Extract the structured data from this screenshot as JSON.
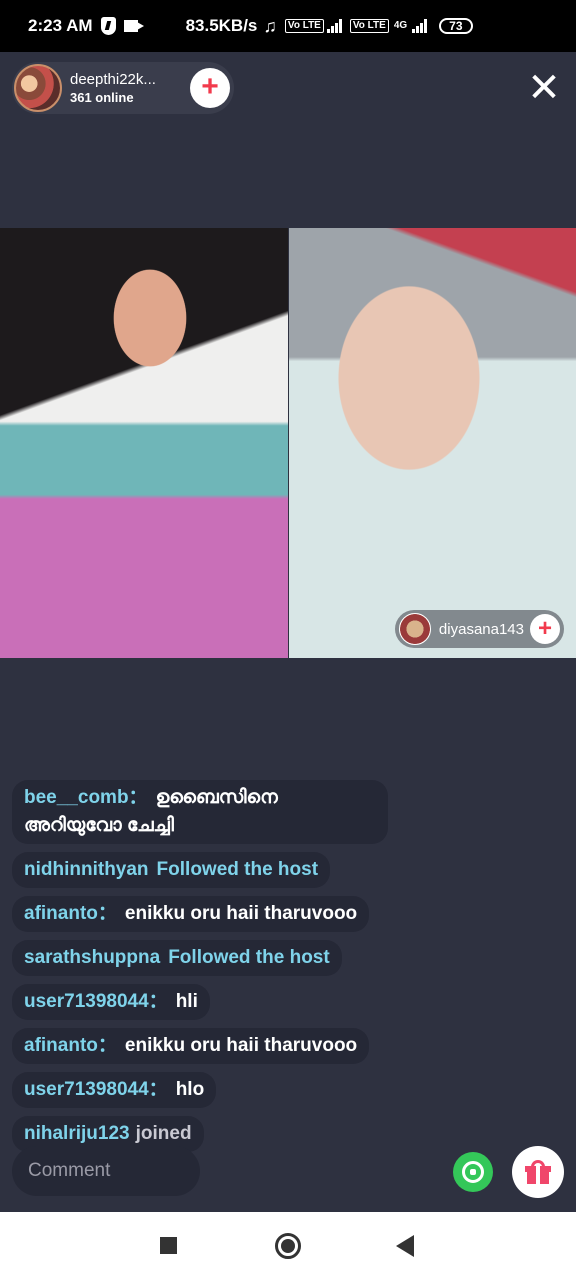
{
  "status_bar": {
    "time": "2:23 AM",
    "speed": "83.5KB/s",
    "volte1": "Vo LTE",
    "volte2": "Vo LTE",
    "network": "4G",
    "battery": "73"
  },
  "host": {
    "name": "deepthi22k...",
    "online": "361 online",
    "follow_icon": "plus-icon"
  },
  "guest": {
    "name": "diyasana143",
    "follow_icon": "plus-icon"
  },
  "chat": [
    {
      "user": "bee__comb",
      "sep": "：",
      "text": "ഉബൈസിനെ അറിയുവോ ചേച്ചി",
      "type": "message"
    },
    {
      "user": "nidhinnithyan",
      "sep": "",
      "text": "Followed the host",
      "type": "system"
    },
    {
      "user": "afinanto",
      "sep": "：",
      "text": "enikku oru haii tharuvooo",
      "type": "message"
    },
    {
      "user": "sarathshuppna",
      "sep": "",
      "text": "Followed the host",
      "type": "system"
    },
    {
      "user": "user71398044",
      "sep": "：",
      "text": "hli",
      "type": "message"
    },
    {
      "user": "afinanto",
      "sep": "：",
      "text": "enikku oru haii tharuvooo",
      "type": "message"
    },
    {
      "user": "user71398044",
      "sep": "：",
      "text": "hlo",
      "type": "message"
    },
    {
      "user": "nihalriju123",
      "sep": "",
      "text": "joined",
      "type": "joined"
    }
  ],
  "comment": {
    "placeholder": "Comment"
  },
  "colors": {
    "background": "#2e3140",
    "username": "#7fd3ea",
    "accent": "#f23a4c",
    "whatsapp": "#34c759"
  }
}
